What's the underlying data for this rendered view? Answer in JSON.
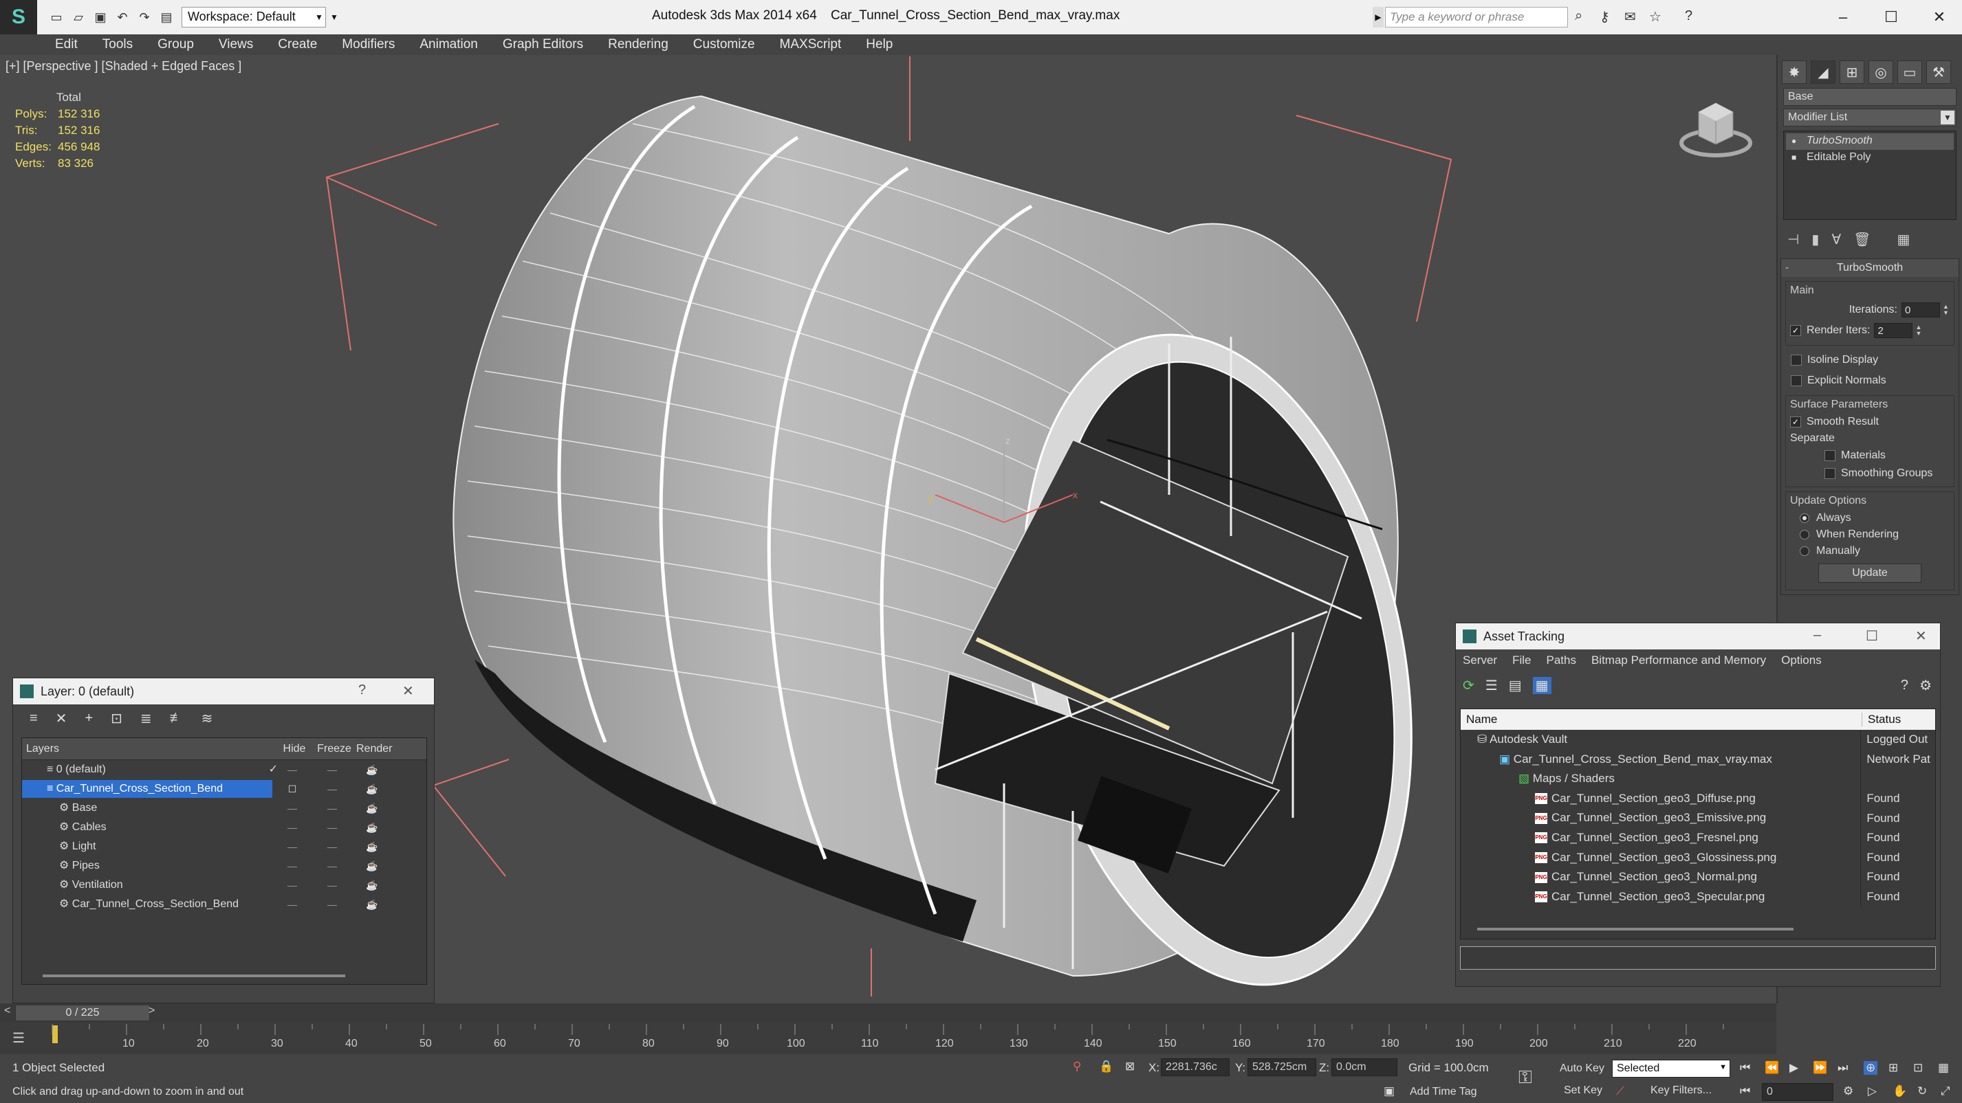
{
  "titlebar": {
    "workspace": "Workspace: Default",
    "app_title": "Autodesk 3ds Max  2014 x64",
    "doc_name": "Car_Tunnel_Cross_Section_Bend_max_vray.max",
    "search_placeholder": "Type a keyword or phrase"
  },
  "menu": [
    "Edit",
    "Tools",
    "Group",
    "Views",
    "Create",
    "Modifiers",
    "Animation",
    "Graph Editors",
    "Rendering",
    "Customize",
    "MAXScript",
    "Help"
  ],
  "viewport": {
    "label": "[+] [Perspective ] [Shaded + Edged Faces ]",
    "stats": {
      "header": "Total",
      "rows": [
        {
          "k": "Polys:",
          "v": "152 316"
        },
        {
          "k": "Tris:",
          "v": "152 316"
        },
        {
          "k": "Edges:",
          "v": "456 948"
        },
        {
          "k": "Verts:",
          "v": "83 326"
        }
      ]
    },
    "axes": {
      "x": "x",
      "y": "y",
      "z": "z"
    }
  },
  "command_panel": {
    "object_name": "Base",
    "modifier_list": "Modifier List",
    "stack": [
      "TurboSmooth",
      "Editable Poly"
    ],
    "turbosmooth": {
      "title": "TurboSmooth",
      "main_label": "Main",
      "iterations_label": "Iterations:",
      "iterations_value": "0",
      "render_iters_label": "Render Iters:",
      "render_iters_value": "2",
      "isoline": "Isoline Display",
      "explicit_normals": "Explicit Normals",
      "surface_params": "Surface Parameters",
      "smooth_result": "Smooth Result",
      "separate": "Separate",
      "materials": "Materials",
      "smoothing_groups": "Smoothing Groups",
      "update_options": "Update Options",
      "always": "Always",
      "when_rendering": "When Rendering",
      "manually": "Manually",
      "update_button": "Update"
    }
  },
  "layer_dialog": {
    "title": "Layer: 0 (default)",
    "help": "?",
    "columns": {
      "layers": "Layers",
      "hide": "Hide",
      "freeze": "Freeze",
      "render": "Render"
    },
    "rows": [
      {
        "name": "0 (default)",
        "indent": 1,
        "selected": false
      },
      {
        "name": "Car_Tunnel_Cross_Section_Bend",
        "indent": 1,
        "selected": true
      },
      {
        "name": "Base",
        "indent": 2,
        "selected": false
      },
      {
        "name": "Cables",
        "indent": 2,
        "selected": false
      },
      {
        "name": "Light",
        "indent": 2,
        "selected": false
      },
      {
        "name": "Pipes",
        "indent": 2,
        "selected": false
      },
      {
        "name": "Ventilation",
        "indent": 2,
        "selected": false
      },
      {
        "name": "Car_Tunnel_Cross_Section_Bend",
        "indent": 2,
        "selected": false
      }
    ]
  },
  "asset_tracking": {
    "title": "Asset Tracking",
    "menu": [
      "Server",
      "File",
      "Paths",
      "Bitmap Performance and Memory",
      "Options"
    ],
    "columns": {
      "name": "Name",
      "status": "Status"
    },
    "rows": [
      {
        "name": "Autodesk Vault",
        "status": "Logged Out",
        "indent": 0,
        "icon": "vault"
      },
      {
        "name": "Car_Tunnel_Cross_Section_Bend_max_vray.max",
        "status": "Network Pat",
        "indent": 1,
        "icon": "max"
      },
      {
        "name": "Maps / Shaders",
        "status": "",
        "indent": 2,
        "icon": "maps"
      },
      {
        "name": "Car_Tunnel_Section_geo3_Diffuse.png",
        "status": "Found",
        "indent": 3,
        "icon": "png"
      },
      {
        "name": "Car_Tunnel_Section_geo3_Emissive.png",
        "status": "Found",
        "indent": 3,
        "icon": "png"
      },
      {
        "name": "Car_Tunnel_Section_geo3_Fresnel.png",
        "status": "Found",
        "indent": 3,
        "icon": "png"
      },
      {
        "name": "Car_Tunnel_Section_geo3_Glossiness.png",
        "status": "Found",
        "indent": 3,
        "icon": "png"
      },
      {
        "name": "Car_Tunnel_Section_geo3_Normal.png",
        "status": "Found",
        "indent": 3,
        "icon": "png"
      },
      {
        "name": "Car_Tunnel_Section_geo3_Specular.png",
        "status": "Found",
        "indent": 3,
        "icon": "png"
      }
    ]
  },
  "timeline": {
    "frame": "0 / 225",
    "ticks": [
      "10",
      "20",
      "30",
      "40",
      "50",
      "60",
      "70",
      "80",
      "90",
      "100",
      "110",
      "120",
      "130",
      "140",
      "150",
      "160",
      "170",
      "180",
      "190",
      "200",
      "210",
      "220"
    ]
  },
  "status": {
    "selected": "1 Object Selected",
    "prompt": "Click and drag up-and-down to zoom in and out",
    "x_label": "X:",
    "x_value": "2281.736c",
    "y_label": "Y:",
    "y_value": "528.725cm",
    "z_label": "Z:",
    "z_value": "0.0cm",
    "grid": "Grid = 100.0cm",
    "add_time_tag": "Add Time Tag",
    "auto_key": "Auto Key",
    "selected_dropdown": "Selected",
    "set_key": "Set Key",
    "key_filters": "Key Filters...",
    "frame_value": "0"
  }
}
